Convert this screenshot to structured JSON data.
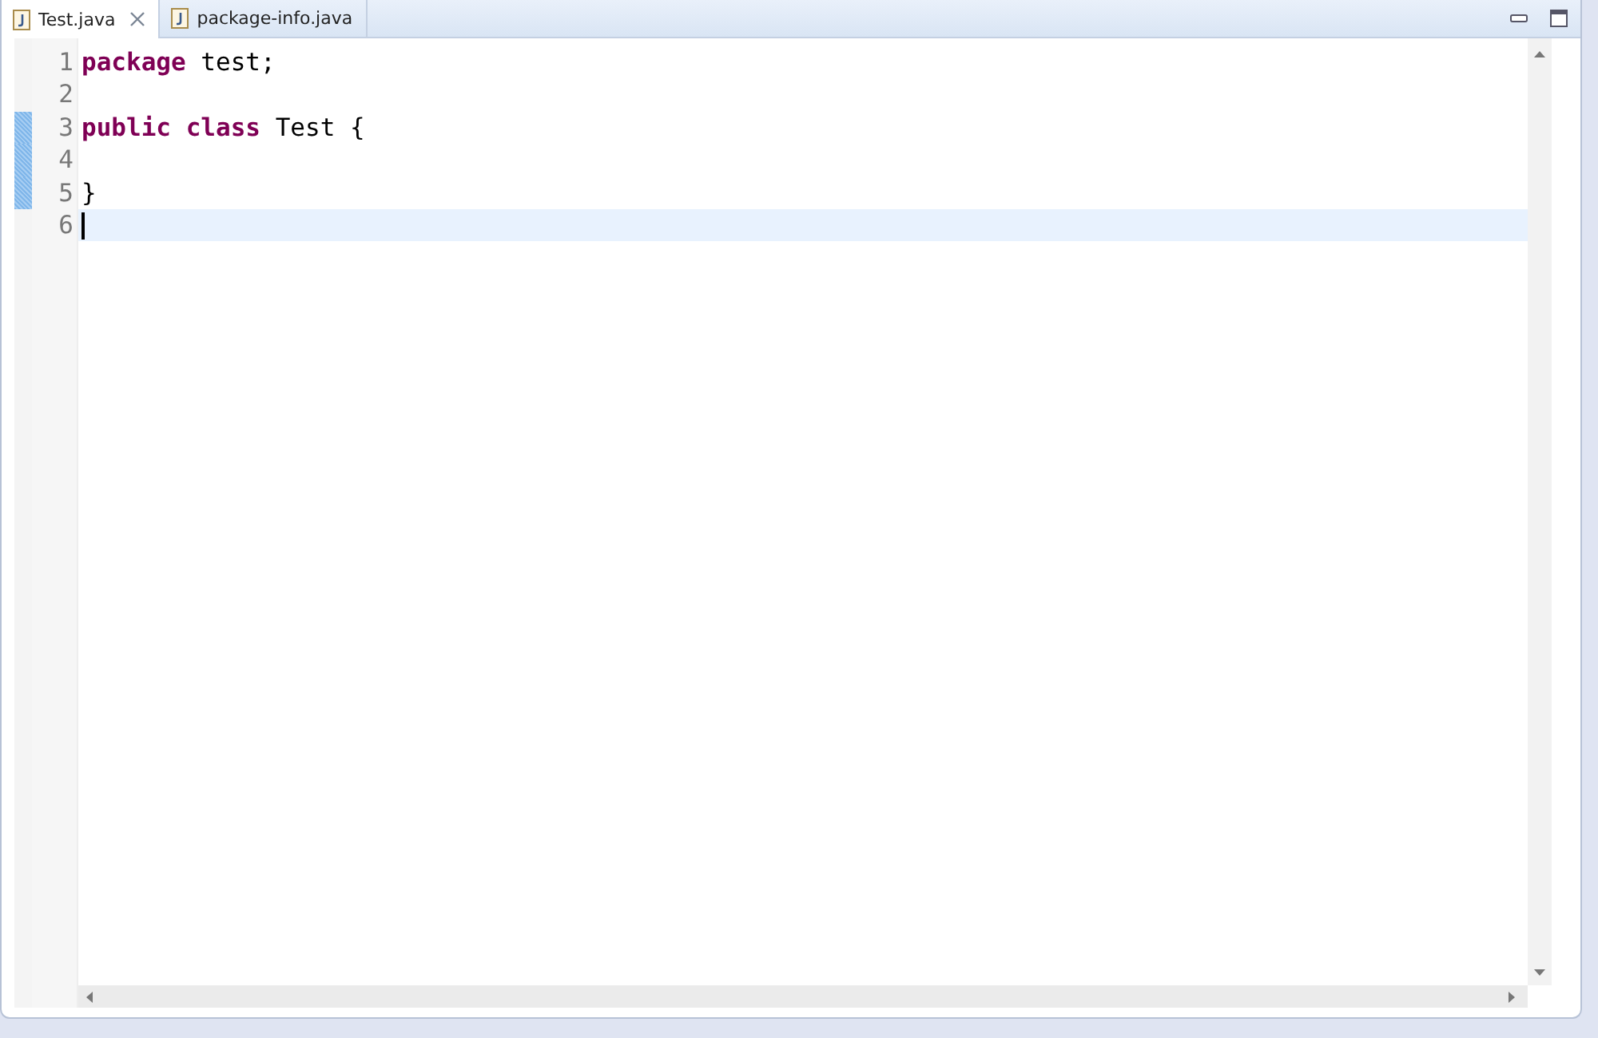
{
  "tabs": [
    {
      "label": "Test.java",
      "selected": true
    },
    {
      "label": "package-info.java",
      "selected": false
    }
  ],
  "lines": [
    {
      "number": "1",
      "changed": false,
      "current": false,
      "tokens": [
        {
          "text": "package",
          "kind": "keyword"
        },
        {
          "text": " test;",
          "kind": "plain"
        }
      ]
    },
    {
      "number": "2",
      "changed": false,
      "current": false
    },
    {
      "number": "3",
      "changed": true,
      "current": false,
      "tokens": [
        {
          "text": "public",
          "kind": "keyword"
        },
        {
          "text": " class",
          "kind": "keyword"
        },
        {
          "text": " Test {",
          "kind": "plain"
        }
      ]
    },
    {
      "number": "4",
      "changed": true,
      "current": false
    },
    {
      "number": "5",
      "changed": true,
      "current": false,
      "tokens": [
        {
          "text": "}",
          "kind": "plain"
        }
      ]
    },
    {
      "number": "6",
      "changed": false,
      "current": true
    }
  ]
}
